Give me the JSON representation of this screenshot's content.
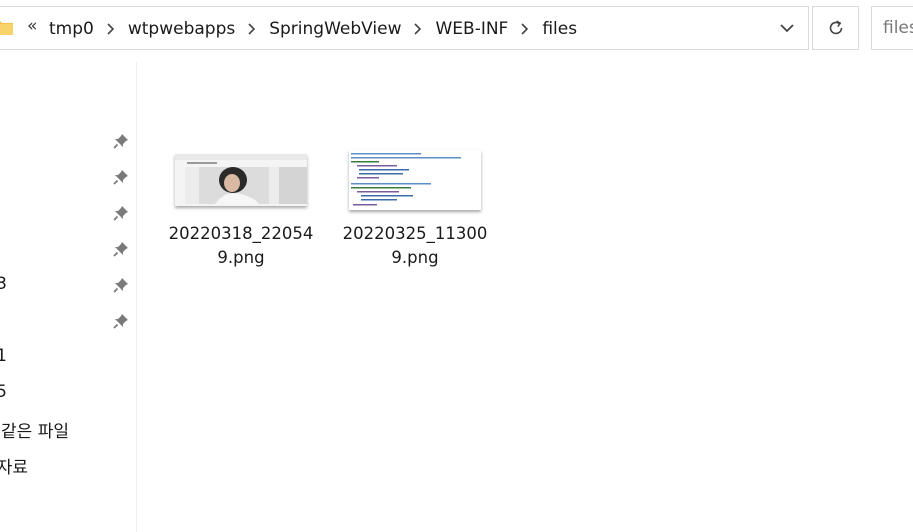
{
  "address_bar": {
    "overflow_glyph": "«",
    "crumbs": [
      "tmp0",
      "wtpwebapps",
      "SpringWebView",
      "WEB-INF",
      "files"
    ]
  },
  "search": {
    "placeholder": "files"
  },
  "nav": {
    "truncated_items": [
      "3",
      "1",
      "5",
      "같은 파일",
      "자료"
    ]
  },
  "files": [
    {
      "name_line1": "20220318_22054",
      "name_line2": "9.png"
    },
    {
      "name_line1": "20220325_11300",
      "name_line2": "9.png"
    }
  ],
  "colors": {
    "folder": "#f5c242",
    "border": "#d9d9d9",
    "text": "#1a1a1a"
  }
}
